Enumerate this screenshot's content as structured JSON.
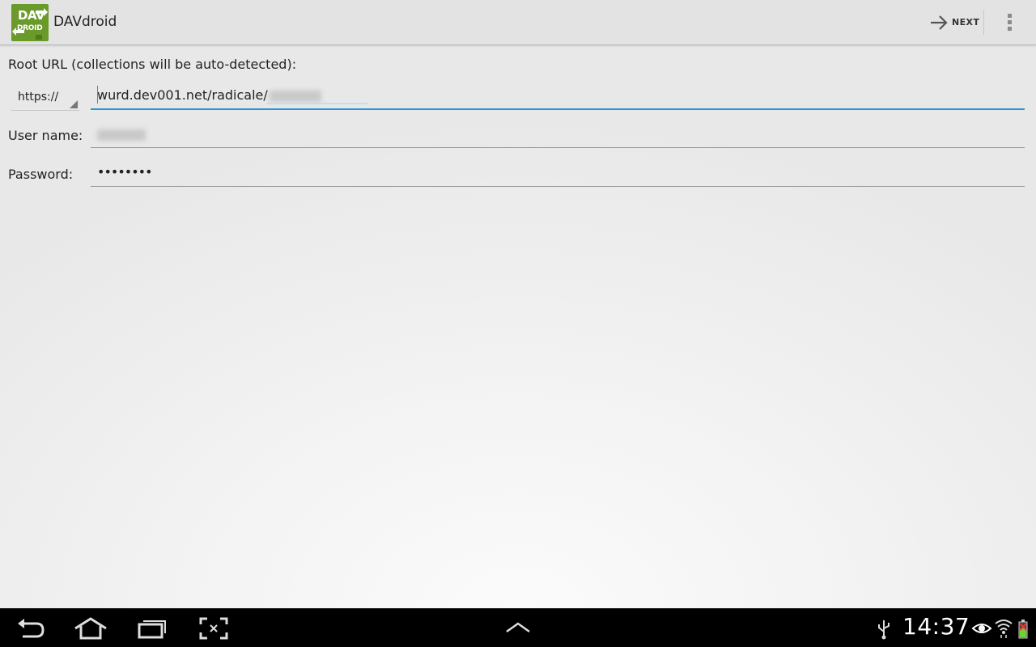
{
  "app": {
    "logo_line1": "DAV",
    "logo_line2": "DROID",
    "title": "DAVdroid"
  },
  "toolbar": {
    "next_label": "NEXT",
    "next_icon": "arrow-right-icon",
    "overflow_icon": "overflow-menu-icon"
  },
  "form": {
    "root_url_label": "Root URL (collections will be auto-detected):",
    "protocol": {
      "selected": "https://"
    },
    "url_value": "wurd.dev001.net/radicale/",
    "username_label": "User name:",
    "password_label": "Password:",
    "password_value": "••••••••"
  },
  "statusbar": {
    "time": "14:37",
    "icons": [
      "usb-icon",
      "eye-icon",
      "wifi-icon",
      "battery-icon"
    ]
  },
  "navbar": {
    "icons": [
      "back-icon",
      "home-icon",
      "recent-apps-icon",
      "screenshot-icon",
      "chevron-up-icon"
    ]
  },
  "colors": {
    "accent": "#2f95cf",
    "logo": "#6a9a2a"
  }
}
